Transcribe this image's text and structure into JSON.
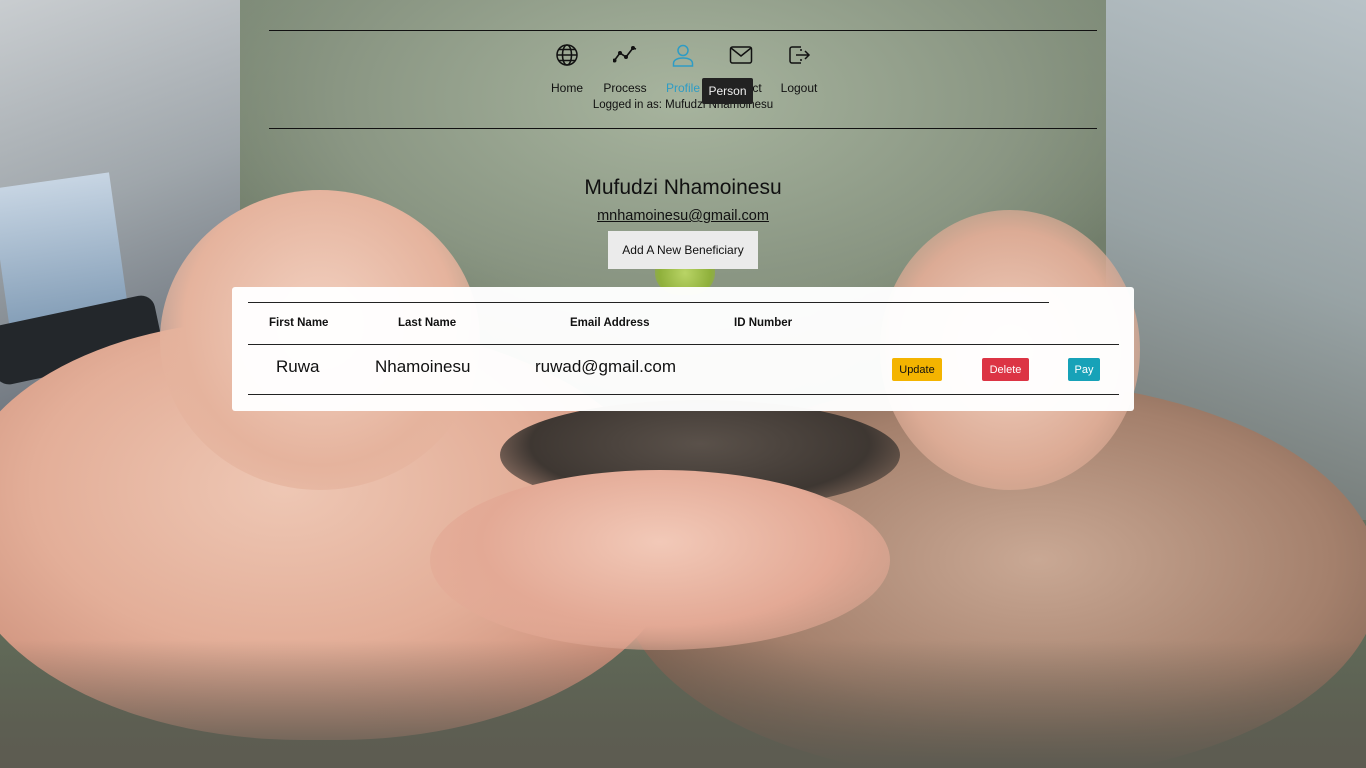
{
  "nav": {
    "items": [
      {
        "label": "Home",
        "icon": "globe-icon"
      },
      {
        "label": "Process",
        "icon": "activity-icon"
      },
      {
        "label": "Profile",
        "icon": "person-icon"
      },
      {
        "label": "Contact",
        "icon": "mail-icon"
      },
      {
        "label": "Logout",
        "icon": "logout-icon"
      }
    ],
    "active": "Profile",
    "logged_in_text": "Logged in as: Mufudzi Nhamoinesu",
    "tooltip": "Person"
  },
  "profile": {
    "name": "Mufudzi Nhamoinesu",
    "email": "mnhamoinesu@gmail.com",
    "add_button": "Add A New Beneficiary"
  },
  "table": {
    "headers": [
      "First Name",
      "Last Name",
      "Email Address",
      "ID Number"
    ],
    "rows": [
      {
        "first_name": "Ruwa",
        "last_name": "Nhamoinesu",
        "email": "ruwad@gmail.com",
        "id_number": "",
        "actions": {
          "update": "Update",
          "delete": "Delete",
          "pay": "Pay"
        }
      }
    ]
  },
  "colors": {
    "active_nav": "#2e9cc5",
    "update": "#f4b400",
    "delete": "#dc3444",
    "pay": "#17a2b8"
  }
}
